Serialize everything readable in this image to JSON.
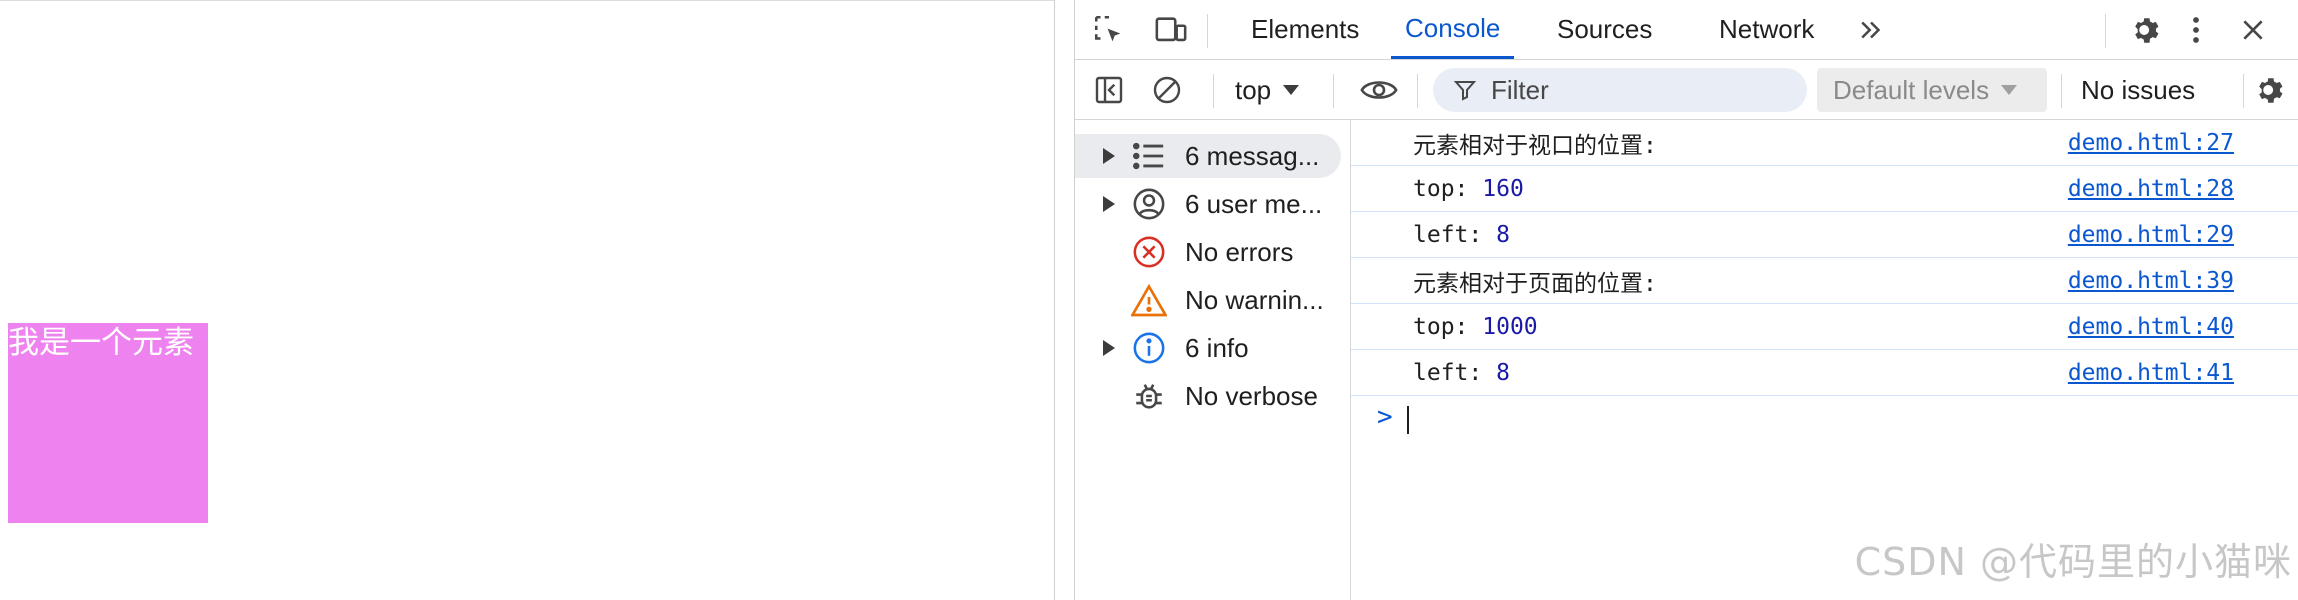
{
  "page": {
    "box_text": "我是一个元素",
    "box_color": "#ee82ee"
  },
  "devtools": {
    "tabs": [
      {
        "label": "Elements",
        "active": false
      },
      {
        "label": "Console",
        "active": true
      },
      {
        "label": "Sources",
        "active": false
      },
      {
        "label": "Network",
        "active": false
      }
    ],
    "accent_color": "#0b57d0",
    "toolbar": {
      "context": "top",
      "filter_placeholder": "Filter",
      "levels": "Default levels",
      "issues": "No issues"
    },
    "sidebar": [
      {
        "label": "6 messag...",
        "icon": "list-icon",
        "expandable": true,
        "selected": true
      },
      {
        "label": "6 user me...",
        "icon": "user-icon",
        "expandable": true,
        "selected": false
      },
      {
        "label": "No errors",
        "icon": "error-icon",
        "expandable": false,
        "selected": false
      },
      {
        "label": "No warnin...",
        "icon": "warning-icon",
        "expandable": false,
        "selected": false
      },
      {
        "label": "6 info",
        "icon": "info-icon",
        "expandable": true,
        "selected": false
      },
      {
        "label": "No verbose",
        "icon": "bug-icon",
        "expandable": false,
        "selected": false
      }
    ],
    "logs": [
      {
        "key": "元素相对于视口的位置:",
        "value": "",
        "source": "demo.html:27"
      },
      {
        "key": "top: ",
        "value": "160",
        "source": "demo.html:28"
      },
      {
        "key": "left: ",
        "value": "8",
        "source": "demo.html:29"
      },
      {
        "key": "元素相对于页面的位置:",
        "value": "",
        "source": "demo.html:39"
      },
      {
        "key": "top: ",
        "value": "1000",
        "source": "demo.html:40"
      },
      {
        "key": "left: ",
        "value": "8",
        "source": "demo.html:41"
      }
    ],
    "prompt": ">"
  },
  "watermark": "CSDN @代码里的小猫咪"
}
